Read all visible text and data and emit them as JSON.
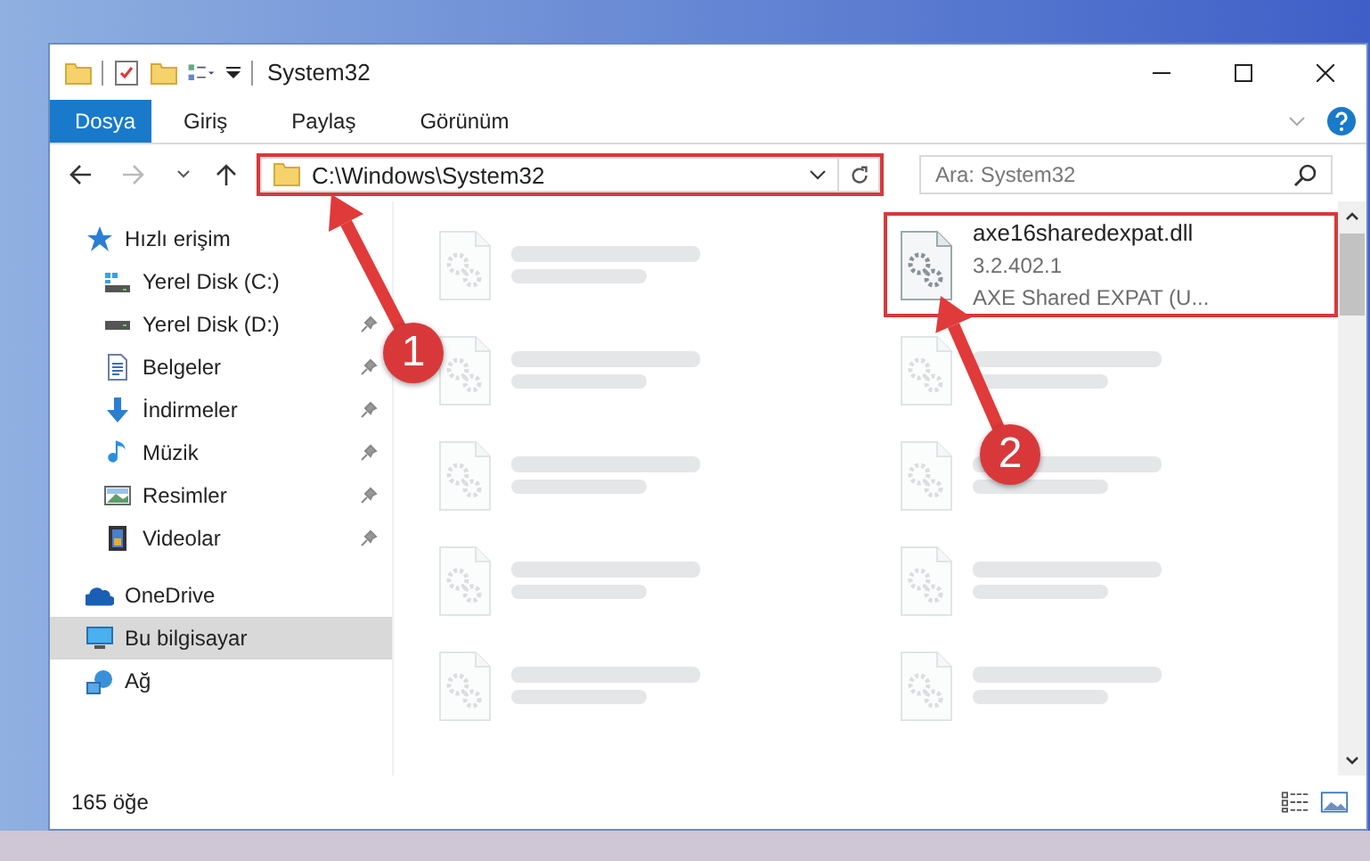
{
  "window": {
    "title": "System32"
  },
  "ribbon_tabs": [
    {
      "label": "Dosya",
      "kind": "file"
    },
    {
      "label": "Giriş",
      "kind": "tab"
    },
    {
      "label": "Paylaş",
      "kind": "tab"
    },
    {
      "label": "Görünüm",
      "kind": "tab"
    }
  ],
  "address": {
    "path": "C:\\Windows\\System32",
    "highlighted": true
  },
  "search": {
    "placeholder": "Ara: System32"
  },
  "sidebar": {
    "items": [
      {
        "label": "Hızlı erişim",
        "kind": "star",
        "selected": false,
        "children": [
          {
            "label": "Yerel Disk (C:)",
            "kind": "sysdisk",
            "pinned": false,
            "selected": false
          },
          {
            "label": "Yerel Disk (D:)",
            "kind": "disk",
            "pinned": true,
            "selected": false
          },
          {
            "label": "Belgeler",
            "kind": "doc",
            "pinned": true,
            "selected": false
          },
          {
            "label": "İndirmeler",
            "kind": "down",
            "pinned": true,
            "selected": false
          },
          {
            "label": "Müzik",
            "kind": "music",
            "pinned": true,
            "selected": false
          },
          {
            "label": "Resimler",
            "kind": "image",
            "pinned": true,
            "selected": false
          },
          {
            "label": "Videolar",
            "kind": "video",
            "pinned": true,
            "selected": false
          }
        ]
      },
      {
        "label": "OneDrive",
        "kind": "cloud",
        "selected": false
      },
      {
        "label": "Bu bilgisayar",
        "kind": "pc",
        "selected": true
      },
      {
        "label": "Ağ",
        "kind": "net",
        "selected": false
      }
    ]
  },
  "files": [
    {
      "kind": "blurred"
    },
    {
      "kind": "file",
      "name": "axe16sharedexpat.dll",
      "version": "3.2.402.1",
      "description": "AXE Shared EXPAT (U...",
      "highlighted": true
    },
    {
      "kind": "blurred"
    },
    {
      "kind": "blurred"
    },
    {
      "kind": "blurred"
    },
    {
      "kind": "blurred"
    },
    {
      "kind": "blurred"
    },
    {
      "kind": "blurred"
    },
    {
      "kind": "blurred"
    },
    {
      "kind": "blurred"
    }
  ],
  "status_bar": {
    "count": "165 öğe"
  },
  "annotations": [
    {
      "number": "1"
    },
    {
      "number": "2"
    }
  ]
}
